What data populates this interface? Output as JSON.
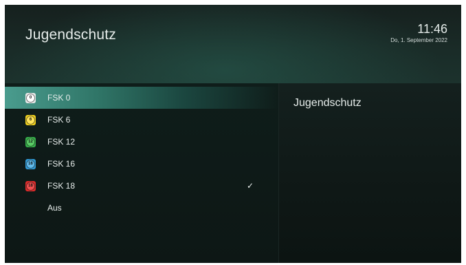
{
  "header": {
    "title": "Jugendschutz",
    "time": "11:46",
    "date": "Do, 1. September 2022"
  },
  "list": {
    "items": [
      {
        "label": "FSK 0",
        "badge_text": "0",
        "badge_color": "#e8e8e8",
        "selected": true,
        "checked": false
      },
      {
        "label": "FSK 6",
        "badge_text": "6",
        "badge_color": "#f2d21b",
        "selected": false,
        "checked": false
      },
      {
        "label": "FSK 12",
        "badge_text": "12",
        "badge_color": "#35b04a",
        "selected": false,
        "checked": false
      },
      {
        "label": "FSK 16",
        "badge_text": "16",
        "badge_color": "#2f9ad6",
        "selected": false,
        "checked": false
      },
      {
        "label": "FSK 18",
        "badge_text": "18",
        "badge_color": "#e02a2a",
        "selected": false,
        "checked": true
      },
      {
        "label": "Aus",
        "badge_text": "",
        "badge_color": "",
        "selected": false,
        "checked": false
      }
    ],
    "check_mark": "✓"
  },
  "detail": {
    "title": "Jugendschutz"
  },
  "colors": {
    "accent": "#3f8f81",
    "background": "#0c1513"
  }
}
